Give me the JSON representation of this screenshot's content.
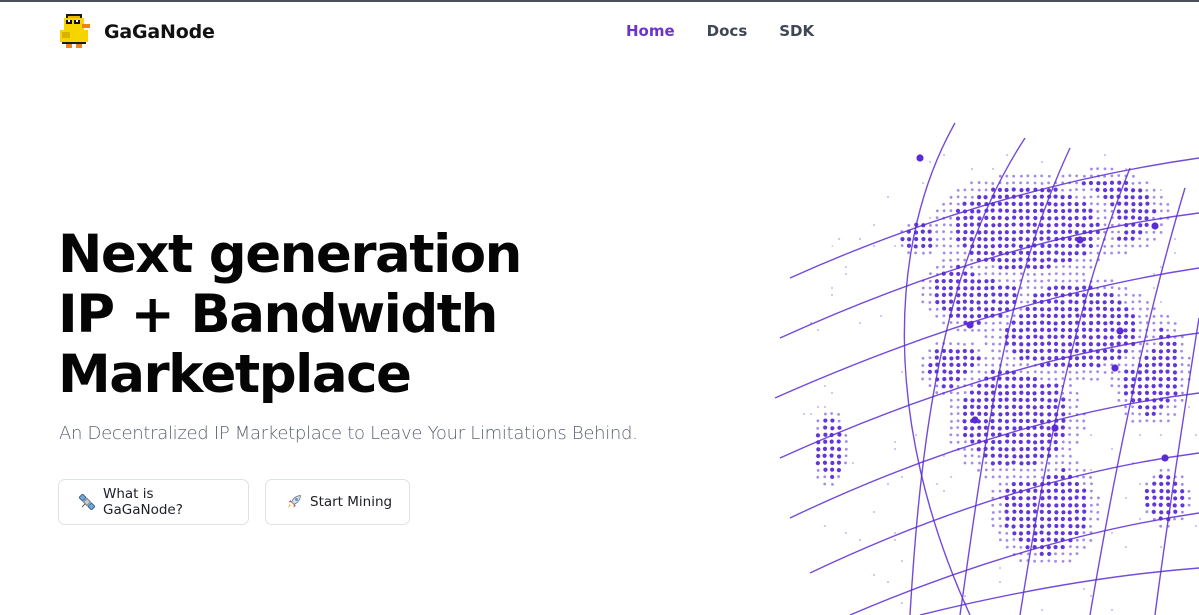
{
  "brand": {
    "name": "GaGaNode",
    "logo_icon": "pixel-duck-icon"
  },
  "nav": [
    {
      "label": "Home",
      "active": true
    },
    {
      "label": "Docs",
      "active": false
    },
    {
      "label": "SDK",
      "active": false
    }
  ],
  "hero": {
    "title_lines": [
      "Next generation",
      "IP + Bandwidth",
      "Marketplace"
    ],
    "subtitle": "An Decentralized IP Marketplace to Leave Your Limitations Behind.",
    "buttons": [
      {
        "label": "What is GaGaNode?",
        "icon": "satellite-icon"
      },
      {
        "label": "Start Mining",
        "icon": "rocket-icon"
      }
    ]
  },
  "colors": {
    "accent": "#6b35c8",
    "globe": "#5b2bd6",
    "text": "#050505",
    "nav": "#3f4656"
  }
}
